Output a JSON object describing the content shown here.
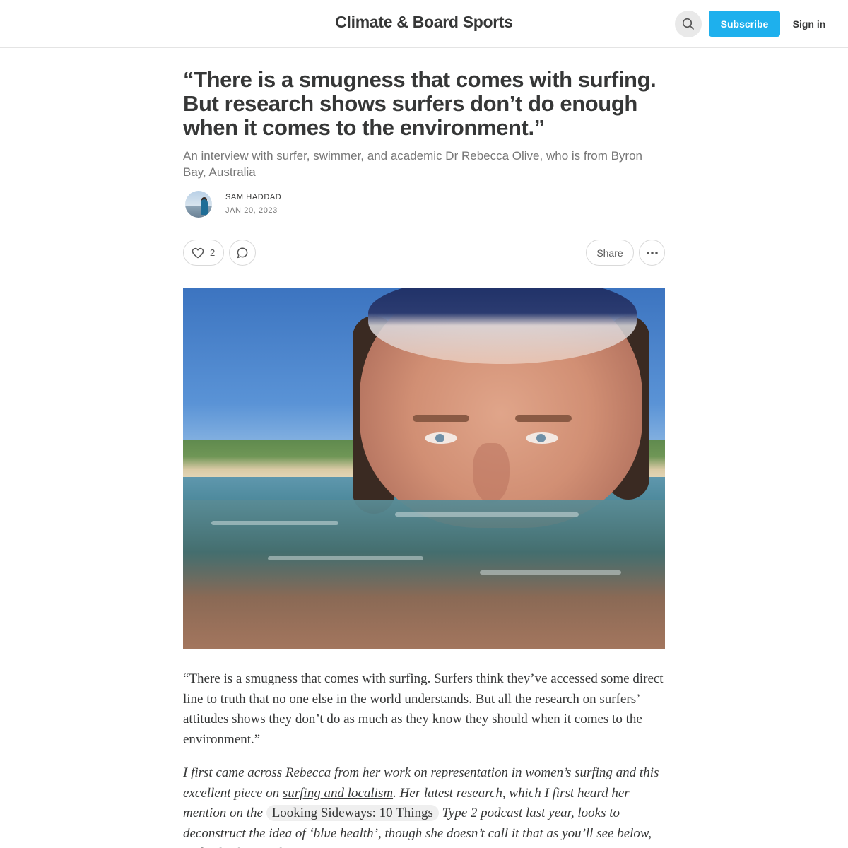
{
  "header": {
    "site_title": "Climate & Board Sports",
    "search_icon": "search-icon",
    "subscribe_label": "Subscribe",
    "signin_label": "Sign in",
    "accent_color": "#1eb0ed"
  },
  "post": {
    "title": "“There is a smugness that comes with surfing. But research shows surfers don’t do enough when it comes to the environment.”",
    "subtitle": "An interview with surfer, swimmer, and academic Dr Rebecca Olive, who is from Byron Bay, Australia",
    "author": "SAM HADDAD",
    "date": "JAN 20, 2023"
  },
  "actions": {
    "like_count": "2",
    "share_label": "Share",
    "icons": [
      "heart-icon",
      "comment-icon",
      "more-icon"
    ]
  },
  "body": {
    "p1": "“There is a smugness that comes with surfing. Surfers think they’ve accessed some direct line to truth that no one else in the world understands. But all the research on surfers’ attitudes shows they don’t do as much as they know they should when it comes to the environment.”",
    "p2_a": "I first came across Rebecca from her work on representation in women’s surfing and this excellent piece on ",
    "p2_link": "surfing and localism",
    "p2_b": ". Her latest research, which I first heard her mention on the ",
    "p2_pill": "Looking Sideways: 10 Things",
    "p2_c": " Type 2 podcast last year, looks to deconstruct the idea of ‘blue health’, though she doesn’t call it that as you’ll see below, and ask why it’s always"
  }
}
